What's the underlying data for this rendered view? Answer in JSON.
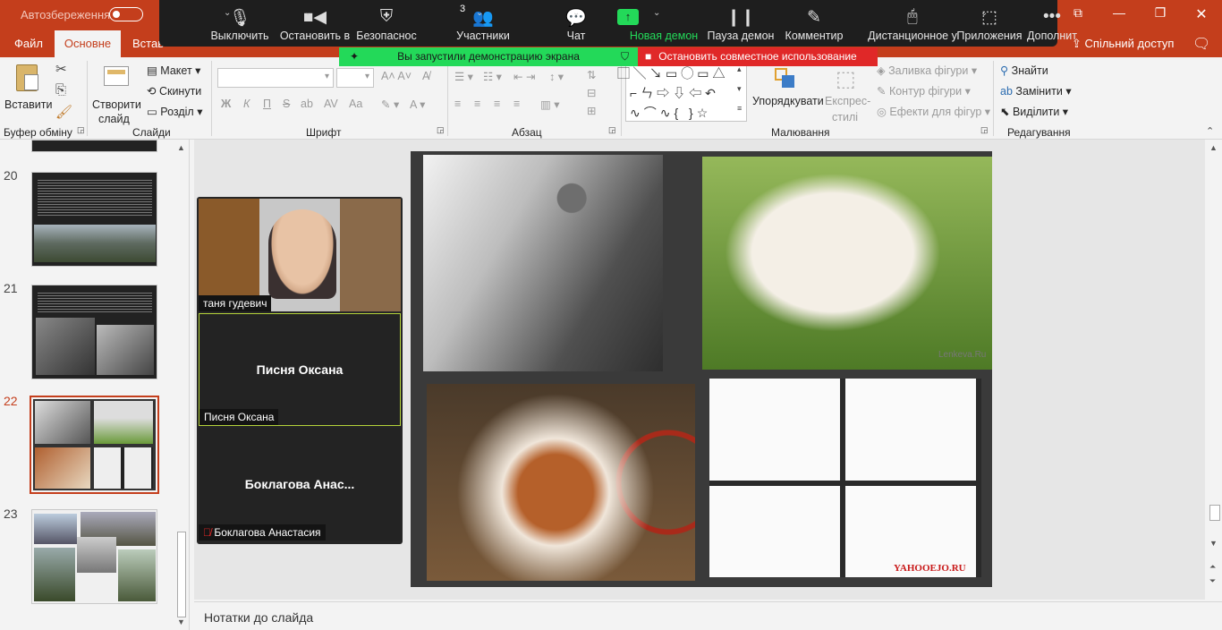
{
  "titlebar": {
    "autosave": "Автозбереження",
    "icons": [
      "restore-icon",
      "minimize-icon",
      "maximize-icon",
      "close-icon"
    ]
  },
  "ribbon_tabs": {
    "file": "Файл",
    "home": "Основне",
    "insert": "Встав",
    "share": "Спільний доступ"
  },
  "ribbon": {
    "clipboard": {
      "paste": "Вставити",
      "group": "Буфер обміну"
    },
    "slides": {
      "new_slide": "Створити",
      "new_slide2": "слайд",
      "layout": "Макет",
      "reset": "Скинути",
      "section": "Розділ",
      "group": "Слайди"
    },
    "font": {
      "bold": "Ж",
      "italic": "К",
      "underline": "П",
      "case": "Aa",
      "group": "Шрифт"
    },
    "paragraph": {
      "group": "Абзац"
    },
    "drawing": {
      "arrange": "Упорядкувати",
      "quick_styles": "Експрес-",
      "quick_styles2": "стилі",
      "fill": "Заливка фігури",
      "outline": "Контур фігури",
      "effects": "Ефекти для фігур",
      "group": "Малювання"
    },
    "editing": {
      "find": "Знайти",
      "replace": "Замінити",
      "select": "Виділити",
      "group": "Редагування"
    }
  },
  "zoom": {
    "mute": "Выключить",
    "video": "Остановить в",
    "security": "Безопаснос",
    "participants": "Участники",
    "participants_count": "3",
    "chat": "Чат",
    "new_share": "Новая демон",
    "pause_share": "Пауза демон",
    "annotate": "Комментир",
    "remote": "Дистанционное у",
    "apps": "Приложения",
    "more": "Дополнит"
  },
  "banners": {
    "sharing": "Вы запустили демонстрацию экрана",
    "stop": "Остановить совместное использование"
  },
  "slides": [
    {
      "num": "20"
    },
    {
      "num": "21"
    },
    {
      "num": "22"
    },
    {
      "num": "23"
    }
  ],
  "video": {
    "tile1_name": "таня гудевич",
    "tile2_display": "Писня Оксана",
    "tile2_name": "Писня Оксана",
    "tile3_display": "Боклагова  Анас...",
    "tile3_name": "Боклагова Анастасия"
  },
  "slide_content": {
    "watermark1": "Lenkeva.Ru",
    "watermark2": "YAHOOEJO.RU"
  },
  "notes": {
    "placeholder": "Нотатки до слайда"
  },
  "colors": {
    "brand": "#c43e1c",
    "zoom_bar": "#1e1e1e",
    "sharing_green": "#23d959",
    "stop_red": "#e02828",
    "selected_slide": "#c43e1c"
  }
}
